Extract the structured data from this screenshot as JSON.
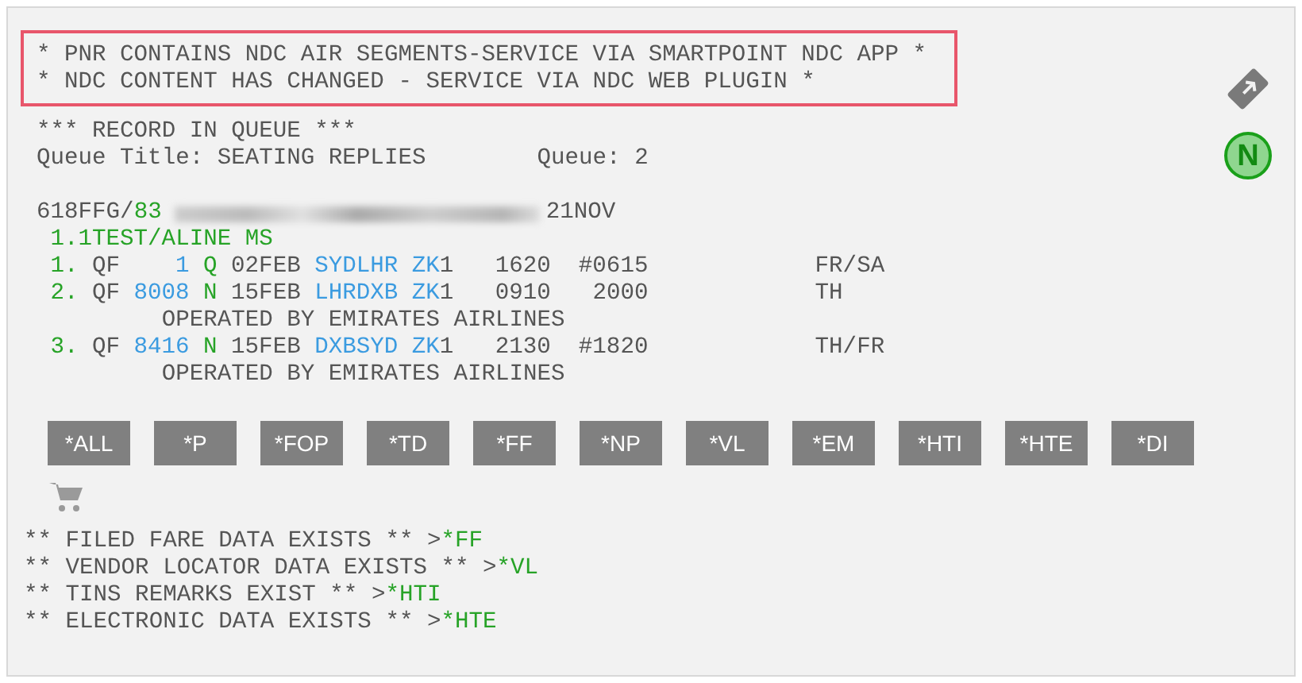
{
  "alert_lines": [
    "* PNR CONTAINS NDC AIR SEGMENTS-SERVICE VIA SMARTPOINT NDC APP *",
    "* NDC CONTENT HAS CHANGED - SERVICE VIA NDC WEB PLUGIN *"
  ],
  "queue": {
    "banner": "*** RECORD IN QUEUE ***",
    "title_label": "Queue Title: SEATING REPLIES",
    "queue_label": "Queue: 2"
  },
  "record": {
    "locator": "618FFG/",
    "agent": "83",
    "date": "21NOV",
    "passenger": "1.1TEST/ALINE MS"
  },
  "segments": [
    {
      "number": "1.",
      "airline": "QF",
      "flight": "1",
      "class": "Q",
      "date": "02FEB",
      "route": "SYDLHR",
      "status": "ZK",
      "seats": "1",
      "depart": "1620",
      "arrive": "#0615",
      "days": "FR/SA"
    },
    {
      "number": "2.",
      "airline": "QF",
      "flight": "8008",
      "class": "N",
      "date": "15FEB",
      "route": "LHRDXB",
      "status": "ZK",
      "seats": "1",
      "depart": "0910",
      "arrive": "2000",
      "days": "TH",
      "operated_by": "OPERATED BY EMIRATES AIRLINES"
    },
    {
      "number": "3.",
      "airline": "QF",
      "flight": "8416",
      "class": "N",
      "date": "15FEB",
      "route": "DXBSYD",
      "status": "ZK",
      "seats": "1",
      "depart": "2130",
      "arrive": "#1820",
      "days": "TH/FR",
      "operated_by": "OPERATED BY EMIRATES AIRLINES"
    }
  ],
  "buttons": [
    "*ALL",
    "*P",
    "*FOP",
    "*TD",
    "*FF",
    "*NP",
    "*VL",
    "*EM",
    "*HTI",
    "*HTE",
    "*DI"
  ],
  "notices": [
    {
      "text": "** FILED FARE DATA EXISTS ** >",
      "command": "*FF"
    },
    {
      "text": "** VENDOR LOCATOR DATA EXISTS ** >",
      "command": "*VL"
    },
    {
      "text": "** TINS REMARKS EXIST ** >",
      "command": "*HTI"
    },
    {
      "text": "** ELECTRONIC DATA EXISTS ** >",
      "command": "*HTE"
    }
  ],
  "badge": "N"
}
